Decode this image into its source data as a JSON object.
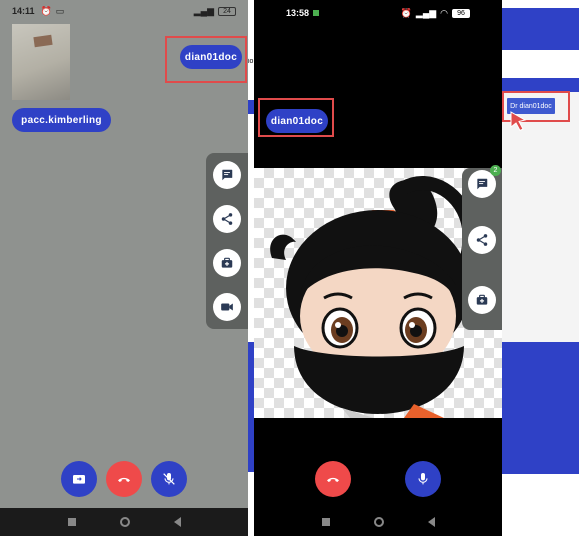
{
  "left_phone": {
    "status": {
      "time": "14:11",
      "battery": "24"
    },
    "local_user": "pacc.kimberling",
    "remote_user": "dian01doc",
    "side_actions": [
      "chat-icon",
      "share-icon",
      "medical-kit-icon",
      "video-camera-icon"
    ],
    "bottom_actions": [
      "switch-camera-icon",
      "end-call-icon",
      "mic-off-icon"
    ]
  },
  "right_phone": {
    "status": {
      "time": "13:58",
      "battery": "96"
    },
    "remote_user": "dian01doc",
    "chat_badge": "2",
    "side_actions": [
      "chat-icon",
      "share-icon",
      "medical-kit-icon"
    ],
    "bottom_actions": [
      "end-call-icon",
      "mic-icon"
    ]
  },
  "web_panel": {
    "doctor_button": "Dr dian01doc"
  },
  "fragments": {
    "clipped_text": "io"
  },
  "colors": {
    "primary_blue": "#2f41c6",
    "end_call_red": "#ef4a4a",
    "highlight_red": "#e04b4b",
    "notification_green": "#4caf50"
  }
}
